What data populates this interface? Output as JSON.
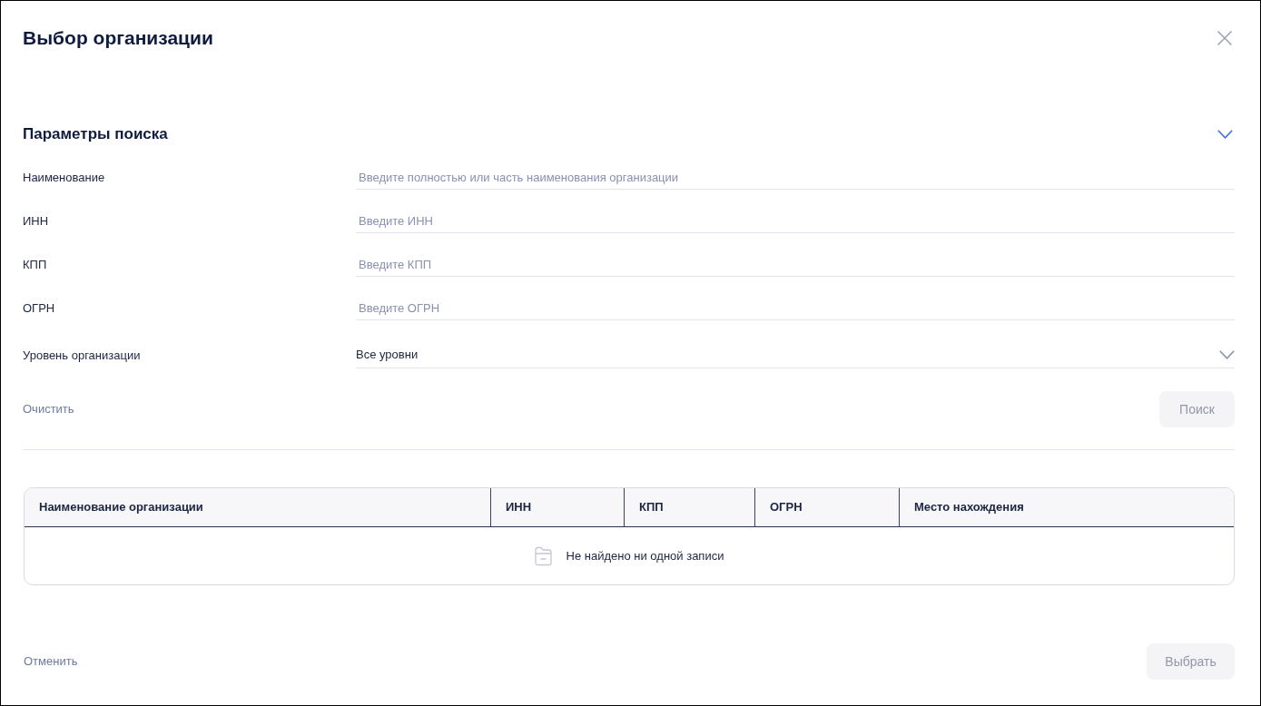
{
  "dialog": {
    "title": "Выбор организации"
  },
  "search_params": {
    "title": "Параметры поиска",
    "expanded": true,
    "fields": [
      {
        "kind": "text",
        "label": "Наименование",
        "placeholder": "Введите полностью или часть наименования организации"
      },
      {
        "kind": "text",
        "label": "ИНН",
        "placeholder": "Введите ИНН"
      },
      {
        "kind": "text",
        "label": "КПП",
        "placeholder": "Введите КПП"
      },
      {
        "kind": "text",
        "label": "ОГРН",
        "placeholder": "Введите ОГРН"
      },
      {
        "kind": "select",
        "label": "Уровень организации",
        "value": "Все уровни"
      }
    ],
    "clear_button": {
      "label": "Очистить"
    },
    "search_button": {
      "label": "Поиск",
      "disabled": true
    }
  },
  "table": {
    "columns": [
      "Наименование организации",
      "ИНН",
      "КПП",
      "ОГРН",
      "Место нахождения"
    ],
    "empty_message": "Не найдено ни одной записи"
  },
  "footer": {
    "cancel_button": {
      "label": "Отменить"
    },
    "select_button": {
      "label": "Выбрать",
      "disabled": true
    }
  }
}
